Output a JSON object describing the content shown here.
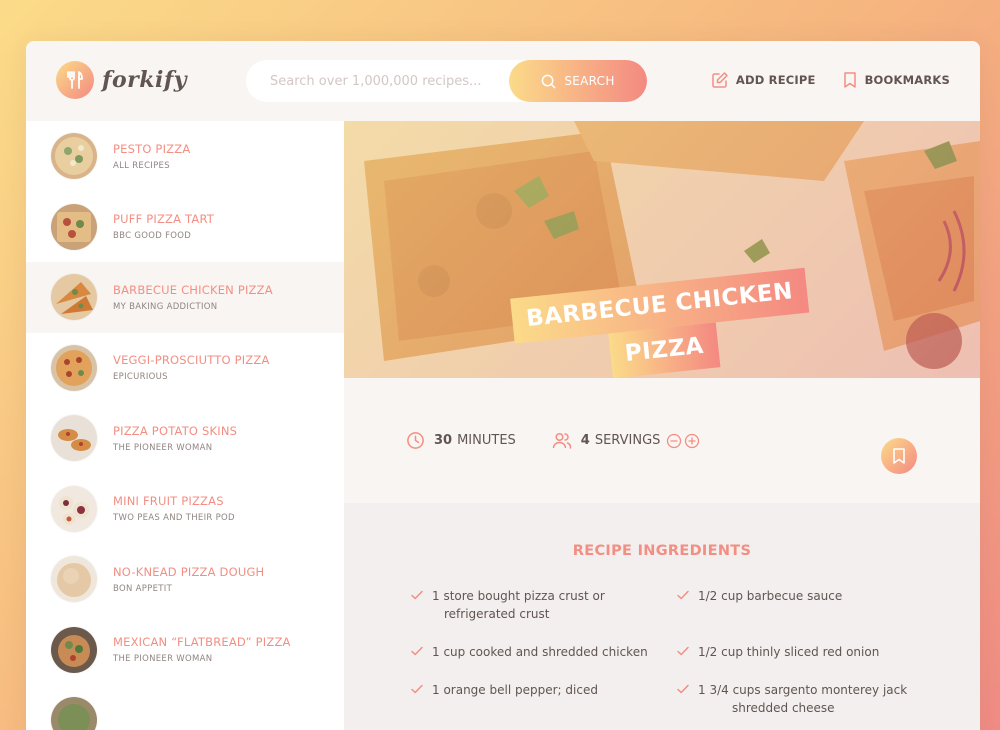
{
  "brand": {
    "name": "forkify"
  },
  "search": {
    "placeholder": "Search over 1,000,000 recipes...",
    "button_label": "SEARCH"
  },
  "nav": {
    "add_recipe": "ADD RECIPE",
    "bookmarks": "BOOKMARKS"
  },
  "results": [
    {
      "title": "PESTO PIZZA",
      "publisher": "ALL RECIPES"
    },
    {
      "title": "PUFF PIZZA TART",
      "publisher": "BBC GOOD FOOD"
    },
    {
      "title": "BARBECUE CHICKEN PIZZA",
      "publisher": "MY BAKING ADDICTION",
      "active": true
    },
    {
      "title": "VEGGI-PROSCIUTTO PIZZA",
      "publisher": "EPICURIOUS"
    },
    {
      "title": "PIZZA POTATO SKINS",
      "publisher": "THE PIONEER WOMAN"
    },
    {
      "title": "MINI FRUIT PIZZAS",
      "publisher": "TWO PEAS AND THEIR POD"
    },
    {
      "title": "NO-KNEAD PIZZA DOUGH",
      "publisher": "BON APPETIT"
    },
    {
      "title": "MEXICAN “FLATBREAD” PIZZA",
      "publisher": "THE PIONEER WOMAN"
    }
  ],
  "recipe": {
    "title_line1": "BARBECUE CHICKEN",
    "title_line2": "PIZZA",
    "cook_time": "30",
    "cook_time_unit": "MINUTES",
    "servings": "4",
    "servings_unit": "SERVINGS",
    "ingredients_heading": "RECIPE INGREDIENTS",
    "ingredients": [
      {
        "line1": "1 store bought pizza crust or",
        "line2": "refrigerated crust"
      },
      {
        "line1": "1/2 cup barbecue sauce",
        "line2": ""
      },
      {
        "line1": "1 cup cooked and shredded chicken",
        "line2": ""
      },
      {
        "line1": "1/2 cup thinly sliced red onion",
        "line2": ""
      },
      {
        "line1": "1 orange bell pepper; diced",
        "line2": ""
      },
      {
        "line1": "1 3/4 cups sargento monterey jack",
        "line2": "shredded cheese"
      }
    ]
  },
  "colors": {
    "accent": "#f38e82",
    "grad_start": "#fbdb89",
    "grad_end": "#f48982",
    "text": "#615551"
  }
}
